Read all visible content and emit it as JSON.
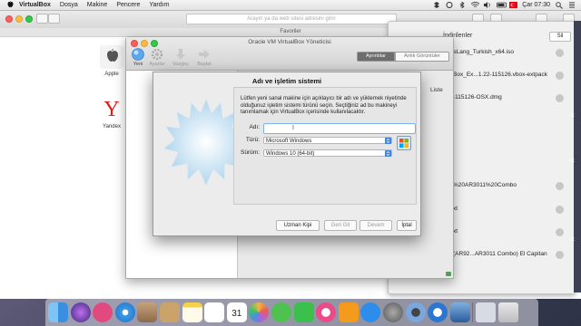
{
  "menubar": {
    "app_name": "VirtualBox",
    "menus": [
      "Dosya",
      "Makine",
      "Pencere",
      "Yardım"
    ],
    "clock": "Çar 07:30"
  },
  "safari": {
    "address_placeholder": "Arayın ya da web sitesi adresini girin",
    "favorites_bar": "Favoriler",
    "favorites": [
      {
        "label": "Apple"
      },
      {
        "label": "Yandex",
        "glyph": "Y"
      }
    ]
  },
  "downloads": {
    "title": "İndirilenler",
    "clear_button": "Sil",
    "items": [
      "eLang_Turkish_x64.iso",
      "Box_Ex...1.22-115126.vbox-extpack",
      "-115126-OSX.dmg",
      "%20AR3011%20Combo",
      "(AR92...AR3011 Combo) El Capitan"
    ],
    "fragments": [
      "xt",
      "xt"
    ]
  },
  "right_edge_fragments": [
    "tx",
    "tx",
    "tx"
  ],
  "vbox_manager": {
    "title": "Oracle VM VirtualBox Yöneticisi",
    "toolbar": [
      {
        "label": "Yeni",
        "icon": "new-machine-icon"
      },
      {
        "label": "Ayarlar",
        "icon": "settings-gear-icon"
      },
      {
        "label": "Vazgeç",
        "icon": "discard-arrow-icon"
      },
      {
        "label": "Başlat",
        "icon": "start-arrow-icon"
      }
    ],
    "segments": [
      "Ayrıntılar",
      "Anlık Görüntüler"
    ],
    "list_label": "Liste"
  },
  "dialog": {
    "title": "Adı ve işletim sistemi",
    "description": "Lütfen yeni sanal makine için açıklayıcı bir adı ve yüklemek niyetinde olduğunuz işletim sistemi türünü seçin. Seçtiğiniz ad bu makineyi tanımlamak için VirtualBox içerisinde kullanılacaktır.",
    "name_label": "Adı:",
    "name_value": "",
    "type_label": "Türü:",
    "type_value": "Microsoft Windows",
    "version_label": "Sürüm:",
    "version_value": "Windows 10 (64-bit)",
    "buttons": {
      "expert": "Uzman Kipi",
      "back": "Geri Git",
      "next": "Devam",
      "cancel": "İptal"
    }
  },
  "dock": {
    "calendar_day": "31",
    "icons": [
      "finder-icon",
      "siri-icon",
      "launchpad-icon",
      "safari-icon",
      "mail-icon",
      "contacts-icon",
      "notes-icon",
      "reminders-icon",
      "calendar-icon",
      "photos-icon",
      "messages-icon",
      "facetime-icon",
      "itunes-icon",
      "ibooks-icon",
      "app-store-icon",
      "system-preferences-icon",
      "quicktime-icon",
      "yandex-browser-icon",
      "virtualbox-icon",
      "trash-icon"
    ]
  },
  "colors": {
    "accent": "#3d84e8",
    "traffic_red": "#fc605c",
    "traffic_yellow": "#fdbc40",
    "traffic_green": "#34c84a"
  }
}
